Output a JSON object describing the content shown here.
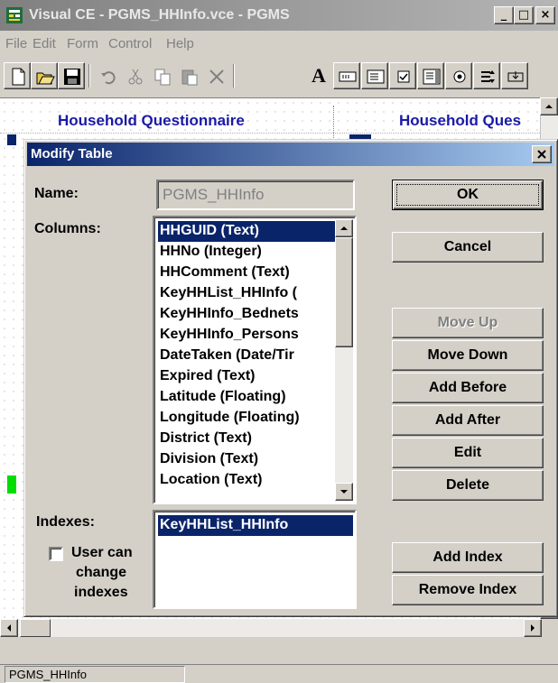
{
  "window": {
    "title": "Visual CE - PGMS_HHInfo.vce - PGMS",
    "minimize": "_",
    "maximize": "□",
    "close": "×"
  },
  "menu": [
    "File",
    "Edit",
    "Form",
    "Control",
    "Help"
  ],
  "toolbar": {
    "text_tool": "A"
  },
  "canvas": {
    "label_left": "Household Questionnaire",
    "label_right": "Household Ques"
  },
  "status": {
    "text": "PGMS_HHInfo"
  },
  "dialog": {
    "title": "Modify Table",
    "name_label": "Name:",
    "name_value": "PGMS_HHInfo",
    "columns_label": "Columns:",
    "columns": [
      "HHGUID (Text)",
      "HHNo (Integer)",
      "HHComment (Text)",
      "KeyHHList_HHInfo (",
      "KeyHHInfo_Bednets",
      "KeyHHInfo_Persons",
      "DateTaken (Date/Tir",
      "Expired (Text)",
      "Latitude (Floating)",
      "Longitude (Floating)",
      "District (Text)",
      "Division (Text)",
      "Location (Text)"
    ],
    "indexes_label": "Indexes:",
    "indexes": [
      "KeyHHList_HHInfo"
    ],
    "user_change_label_1": "User can",
    "user_change_label_2": "change",
    "user_change_label_3": "indexes",
    "buttons": {
      "ok": "OK",
      "cancel": "Cancel",
      "move_up": "Move Up",
      "move_down": "Move Down",
      "add_before": "Add Before",
      "add_after": "Add After",
      "edit": "Edit",
      "delete": "Delete",
      "add_index": "Add Index",
      "remove_index": "Remove Index"
    }
  },
  "colors": {
    "selection": "#0a246a",
    "canvas_label": "#1a1aa6"
  }
}
